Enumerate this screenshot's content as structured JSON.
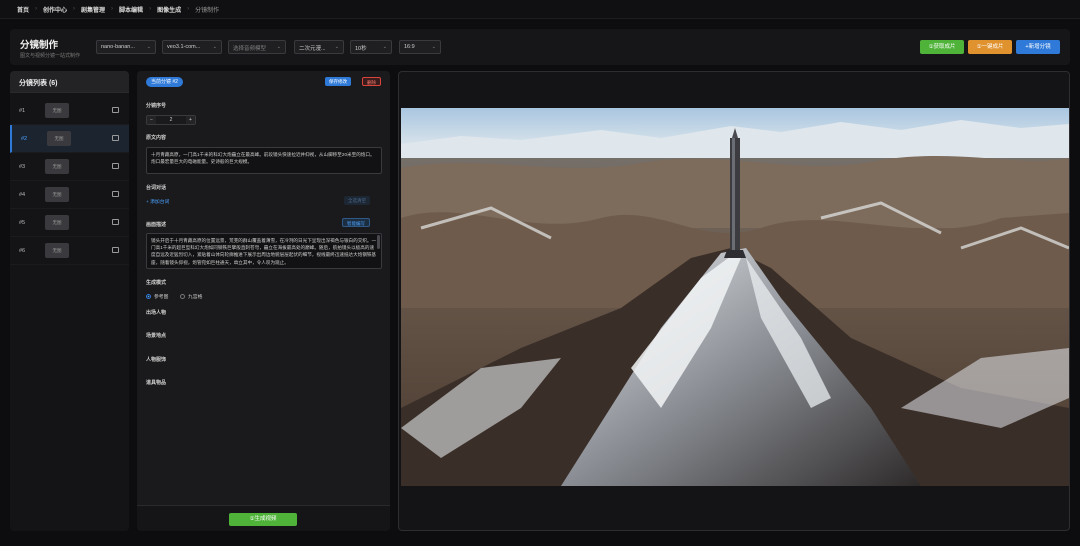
{
  "breadcrumb": [
    "首页",
    "创作中心",
    "剧集管理",
    "脚本编辑",
    "图像生成",
    "分镜制作"
  ],
  "header": {
    "title": "分镜制作",
    "subtitle": "图文与视频分镜一站式制作",
    "image_model": "nano-banan...",
    "video_model": "veo3.1-com...",
    "audio_model_placeholder": "选择音频模型",
    "style": "二次元漫...",
    "duration": "10秒",
    "ratio": "16:9",
    "btn_mark": "①获取成片",
    "btn_oneclick": "①一键成片",
    "btn_add": "+新增分镜"
  },
  "sidebar": {
    "title": "分镜列表 (6)",
    "items": [
      {
        "num": "#1",
        "thumb": "无图"
      },
      {
        "num": "#2",
        "thumb": "无图"
      },
      {
        "num": "#3",
        "thumb": "无图"
      },
      {
        "num": "#4",
        "thumb": "无图"
      },
      {
        "num": "#5",
        "thumb": "无图"
      },
      {
        "num": "#6",
        "thumb": "无图"
      }
    ]
  },
  "editor": {
    "chip": "当前分镜 #2",
    "save_label": "保存修改",
    "delete_label": "删除",
    "seq_label": "分镜序号",
    "seq_value": "2",
    "content_label": "原文内容",
    "content_text": "十月青藏高原，一门高1千米的科幻大炮矗立在最高峰。前段镜头快速拉近并仰视，从山脚移至20米至的炮口。炮口最宏量巨大的电磁能量。史诗般的巨大规模。",
    "dialogue_label": "台词对话",
    "add_dialogue": "+ 添加台词",
    "dialogue_ghost": "全选清空",
    "desc_label": "画面描述",
    "smart_btn": "智能编写",
    "desc_text": "镜头开启于十月青藏高原的位置远景，荒芜的群山覆盖着薄雪，在冷冽的日光下呈现出深褐色与银白的交织。一门高1千米的超巨型科幻大炮如同钢铁巨擘般直刺苍穹，矗立在海拔最高处的巅峰。随后，航拍镜头以极高的速度自远及近猛烈切入，紧贴着山体向轮廓推进下展示出周边地貌层层起伏的细节，视线最终迅速抵达大炮钢铁基座，随着镜头仰视，炮管宛如巨柱通天，耸立其中，令人叹为观止。",
    "mode_label": "生成模式",
    "mode_ref": "参考图",
    "mode_grid": "九宫格",
    "appear_label": "出场人物",
    "scene_label": "场景地点",
    "char_label": "人物服饰",
    "props_label": "道具物品",
    "generate_label": "①生成视频"
  },
  "colors": {
    "accent": "#2f7ad8",
    "green": "#4fb33a",
    "orange": "#e0922f",
    "danger": "#d9443b"
  }
}
